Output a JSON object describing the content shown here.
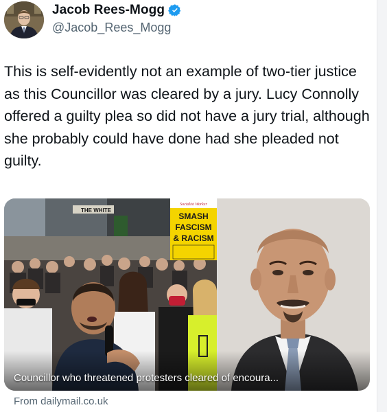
{
  "author": {
    "display_name": "Jacob Rees-Mogg",
    "handle": "@Jacob_Rees_Mogg",
    "verified": true,
    "avatar_icon": "profile-photo",
    "verified_icon": "verified-badge-icon"
  },
  "tweet": {
    "text": "This is self-evidently not an example of two-tier justice as this Councillor was cleared by a jury. Lucy Connolly offered a guilty plea so did not have a jury trial, although she probably could have done had she pleaded not guilty."
  },
  "link_card": {
    "caption": "Councillor who threatened protesters cleared of encoura...",
    "source": "From dailymail.co.uk",
    "placard": {
      "org": "Socialist Worker",
      "lines": [
        "SMASH",
        "FASCISM",
        "& RACISM"
      ]
    },
    "storefront_sign": "THE WHITE"
  },
  "colors": {
    "text": "#0f1419",
    "secondary": "#536471",
    "verified": "#1d9bf0",
    "placard_yellow": "#f4d400"
  }
}
